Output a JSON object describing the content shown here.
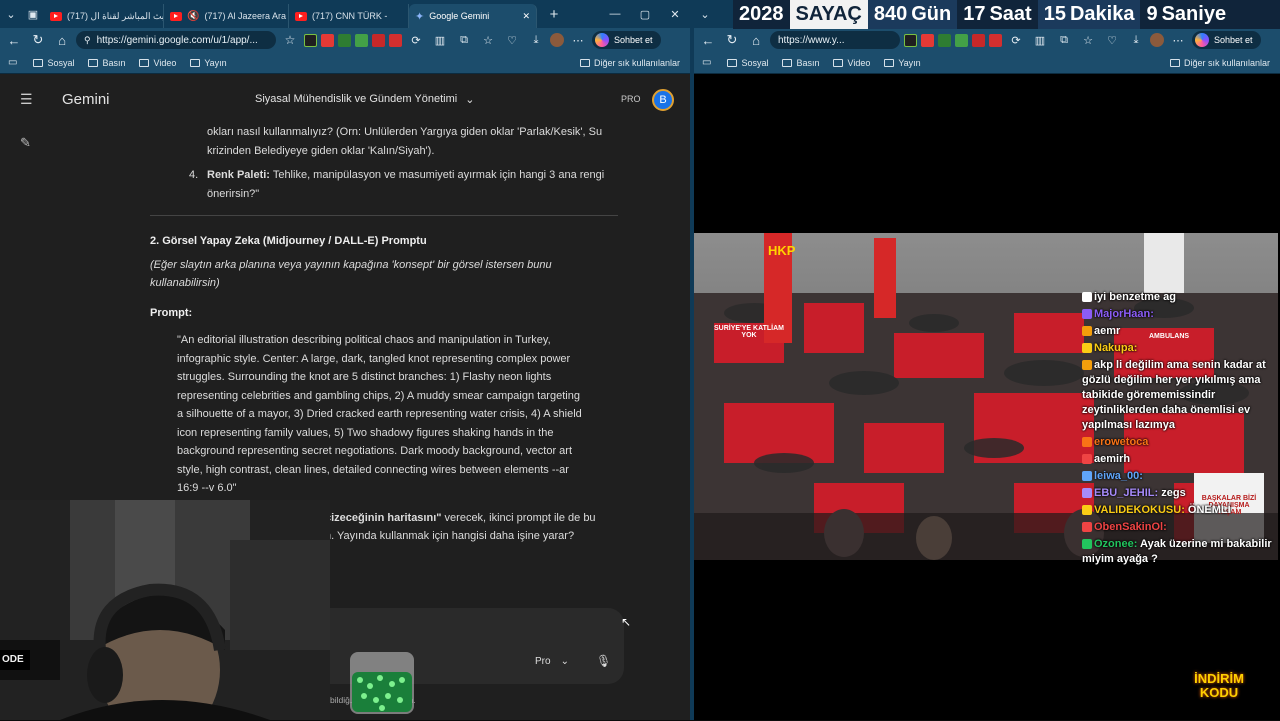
{
  "left_browser": {
    "tabs": [
      {
        "label": "البث المباشر لقناة ال (717)",
        "type": "youtube"
      },
      {
        "label": "(717) Al Jazeera Ara",
        "type": "youtube"
      },
      {
        "label": "(717) CNN TÜRK -",
        "type": "youtube"
      },
      {
        "label": "Google Gemini",
        "type": "gemini",
        "active": true
      }
    ],
    "url": "https://gemini.google.com/u/1/app/...",
    "chat_button": "Sohbet et",
    "bookmarks": [
      "Sosyal",
      "Basın",
      "Video",
      "Yayın"
    ],
    "other_bookmarks": "Diğer sık kullanılanlar"
  },
  "gemini": {
    "brand": "Gemini",
    "conversation_title": "Siyasal Mühendislik ve Gündem Yönetimi",
    "plan_badge": "PRO",
    "avatar_letter": "B",
    "item3_tail": "okları nasıl kullanmalıyız? (Orn: Unlülerden Yargıya giden oklar 'Parlak/Kesik', Su krizinden Belediyeye giden oklar 'Kalın/Siyah').",
    "item4_num": "4.",
    "item4_bold": "Renk Paleti:",
    "item4_text": " Tehlike, manipülasyon ve masumiyeti ayırmak için hangi 3 ana rengi önerirsin?\"",
    "section2_title": "2. Görsel Yapay Zeka (Midjourney / DALL-E) Promptu",
    "section2_note": "(Eğer slaytın arka planına veya yayının kapağına 'konsept' bir görsel istersen bunu kullanabilirsin)",
    "prompt_label": "Prompt:",
    "prompt_text": "\"An editorial illustration describing political chaos and manipulation in Turkey, infographic style. Center: A large, dark, tangled knot representing complex power struggles. Surrounding the knot are 5 distinct branches: 1) Flashy neon lights representing celebrities and gambling chips, 2) A muddy smear campaign targeting a silhouette of a mayor, 3) Dried cracked earth representing water crisis, 4) A shield icon representing family values, 5) Two shadowy figures shaking hands in the background representing secret negotiations. Dark moody background, vector art style, high contrast, clean lines, detailed connecting wires between elements --ar 16:9 --v 6.0\"",
    "tail_bold": "çizeceğinin haritasını\"",
    "tail_text1": " verecek, ikinci prompt ile de bu",
    "tail_text2": "n. Yayında kullanmak için hangisi daha işine yarar?",
    "input_mode": "Pro",
    "disclaimer": "bildiğ... ları doğrulayın."
  },
  "right_browser": {
    "url": "https://www.y...",
    "chat_button": "Sohbet et",
    "bookmarks": [
      "Sosyal",
      "Basın",
      "Video",
      "Yayın"
    ],
    "other_bookmarks": "Diğer sık kullanılanlar"
  },
  "countdown": {
    "year": "2028",
    "label": "SAYAÇ",
    "days": "840",
    "days_unit": "Gün",
    "hours": "17",
    "hours_unit": "Saat",
    "minutes": "15",
    "minutes_unit": "Dakika",
    "seconds": "9",
    "seconds_unit": "Saniye"
  },
  "stream_overlay": {
    "party_sign": "HKP",
    "crowd_signs": [
      "SURİYE'YE KATLİAM YOK",
      "AMBULANS",
      "BAŞKALAR BİZİ DAYANIŞMA YAŞAM"
    ],
    "promo_line1": "İNDİRİM",
    "promo_line2": "KODU"
  },
  "live_chat": [
    {
      "user": "",
      "text": "iyi benzetme ag",
      "color": "#ffffff"
    },
    {
      "user": "MajorHaan:",
      "text": "",
      "color": "#8b5cf6"
    },
    {
      "user": "",
      "text": "aemr",
      "color": "#f59e0b"
    },
    {
      "user": "Nakupa:",
      "text": "",
      "color": "#facc15"
    },
    {
      "user": "",
      "text": "akp li değilim ama senin kadar at gözlü değilim her yer yıkılmış ama tabikide görememissindir zeytinliklerden daha önemlisi ev yapılması lazımya",
      "color": "#f59e0b"
    },
    {
      "user": "erowetoca",
      "text": "",
      "color": "#f97316"
    },
    {
      "user": "",
      "text": "aemirh",
      "color": "#ef4444"
    },
    {
      "user": "leiwa_00:",
      "text": "",
      "color": "#60a5fa"
    },
    {
      "user": "EBU_JEHIL:",
      "text": "zegs",
      "color": "#a78bfa"
    },
    {
      "user": "VALIDEKOKUSU:",
      "text": "ÖNEMLİ",
      "color": "#facc15"
    },
    {
      "user": "ObenSakinOl:",
      "text": "",
      "color": "#ef4444"
    },
    {
      "user": "Ozonee:",
      "text": "Ayak üzerine mi bakabilir miyim ayağa ?",
      "color": "#22c55e"
    }
  ],
  "colors": {
    "chrome_blue": "#1c4d6c",
    "gemini_bg": "#1f1f1f",
    "accent_blue": "#1a73e8"
  }
}
